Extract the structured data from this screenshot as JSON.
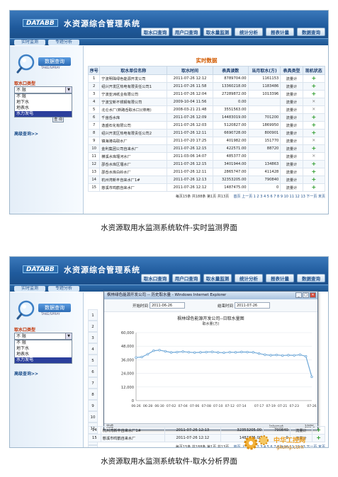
{
  "app": {
    "logo": "DATABB",
    "title": "水资源综合管理系统",
    "nav_tabs": [
      "取水口查询",
      "用户口查询",
      "取水量监测",
      "统计分析",
      "报表计量",
      "数据查询"
    ],
    "subtabs": [
      "实时监测",
      "专题分析"
    ]
  },
  "sidebar": {
    "title": "数据查询",
    "subtitle": "TAKE/SPRAY",
    "type_label": "取水口类型",
    "select_value": "不 限",
    "options": [
      "不 限",
      "地下水",
      "地表水",
      "水力发电"
    ],
    "selected_option": "水力发电",
    "query_button": "查 询",
    "advanced_link": "高级查询>>"
  },
  "realtime": {
    "title": "实时数据",
    "columns": [
      "序号",
      "取水单位名称",
      "取水时间",
      "表具读数",
      "当月取水(方)",
      "表具类型",
      "现机状态"
    ],
    "rows": [
      [
        "1",
        "宁波明珠绿色能源开发公司",
        "2011-07-26 12:12",
        "8789704.00",
        "1161153",
        "流量计"
      ],
      [
        "2",
        "绍兴开发区热电有限责任公司1",
        "2011-07-26 11:58",
        "13360218.00",
        "1183486",
        "流量计"
      ],
      [
        "3",
        "宁波亚洲纸业有限公司",
        "2011-07-26 12:04",
        "27289872.00",
        "1013396",
        "流量计"
      ],
      [
        "4",
        "宁波宝新不锈钢有限公司",
        "2009-10-04 11:56",
        "0.00",
        "",
        "流量计"
      ],
      [
        "5",
        "北仑水厂(新路岙取水口)(停用)",
        "2008-03-21 21:48",
        "3551563.00",
        "",
        "流量计"
      ],
      [
        "6",
        "千亩岙水库",
        "2011-07-26 12:09",
        "14483019.00",
        "701200",
        "流量计"
      ],
      [
        "7",
        "逸盛石化有限公司",
        "2011-07-26 12:03",
        "5120827.00",
        "1869950",
        "流量计"
      ],
      [
        "8",
        "绍兴开发区热电有限责任公司2",
        "2011-07-26 12:11",
        "6690728.00",
        "800901",
        "流量计"
      ],
      [
        "9",
        "镇海港岛取水厂",
        "2011-07-20 17:25",
        "401982.00",
        "151770",
        "流量计"
      ],
      [
        "10",
        "金利集团公司自来水厂",
        "2011-07-26 12:15",
        "422571.00",
        "88720",
        "流量计"
      ],
      [
        "11",
        "横溪水库堰河水厂",
        "2011-03-06 14:07",
        "485377.00",
        "",
        "流量计"
      ],
      [
        "12",
        "邵岙水库区堰水厂",
        "2011-07-26 12:15",
        "3401944.00",
        "134863",
        "流量计"
      ],
      [
        "13",
        "邵岙水库白岭水厂",
        "2011-07-26 12:11",
        "2865747.00",
        "411428",
        "流量计"
      ],
      [
        "14",
        "杭州湾新丰自来水厂1#",
        "2011-07-26 12:13",
        "32353205.00",
        "790840",
        "流量计"
      ],
      [
        "15",
        "慈溪市鸣鹤自来水厂",
        "2011-07-26 12:12",
        "1487475.00",
        "0",
        "流量计"
      ]
    ],
    "status_marks": [
      "+",
      "+",
      "+",
      "✕",
      "✕",
      "+",
      "+",
      "+",
      "✕",
      "+",
      "✕",
      "+",
      "+",
      "+",
      "+"
    ],
    "pager": "每页15条 共188条  第1页 共13页",
    "pager_links": "首页 上一页 1 2 3 4 5 6 7 8 9 10 11 12 13 下一页 末页"
  },
  "popup": {
    "title": "枫林绿色能源开发公司 -- 历史取水量 - Windows Internet Explorer",
    "start_label": "开始时间",
    "start_value": "2011-06-26",
    "end_label": "结束时间",
    "end_value": "2011-07-26",
    "status_left": "完成",
    "status_net": "Internet",
    "status_zoom": "100%"
  },
  "chart_data": {
    "type": "line",
    "title": "枫林绿色能源开发公司--日取水量图",
    "ylabel": "取水量(方)",
    "ylim": [
      0,
      60000
    ],
    "yticks": [
      "60,000",
      "48,000",
      "36,000",
      "24,000",
      "12,000",
      "0"
    ],
    "x": [
      "06-26",
      "06-27",
      "06-28",
      "06-29",
      "06-30",
      "07-01",
      "07-02",
      "07-03",
      "07-04",
      "07-05",
      "07-06",
      "07-07",
      "07-08",
      "07-09",
      "07-10",
      "07-11",
      "07-12",
      "07-13",
      "07-14",
      "07-15",
      "07-16",
      "07-17",
      "07-18",
      "07-19",
      "07-20",
      "07-21",
      "07-22",
      "07-23",
      "07-24",
      "07-25",
      "07-26"
    ],
    "xticks": [
      "06-26",
      "06-28",
      "06-30",
      "07-02",
      "07-04",
      "07-06",
      "07-08",
      "07-10",
      "07-12",
      "07-14",
      "07-17",
      "07-19",
      "07-21",
      "07-23",
      "07-26"
    ],
    "values": [
      38000,
      38500,
      41000,
      44000,
      44500,
      43500,
      42500,
      42800,
      43200,
      42700,
      42400,
      42600,
      42800,
      43000,
      42500,
      42300,
      42700,
      42600,
      42900,
      42800,
      42600,
      41500,
      40500,
      40000,
      40300,
      39800,
      40100,
      39900,
      40500,
      39000,
      21000
    ],
    "color": "#6fa8d8"
  },
  "chart_copy": {
    "title": "枫林绿色能源开发公司--日取水量图",
    "unit": "取水量(方)"
  },
  "bottom_rows": [
    [
      "14",
      "杭州湾新丰自来水厂1#",
      "2011-07-26 12:13",
      "32353205.00",
      "790840",
      "流量计"
    ],
    [
      "15",
      "慈溪市鸣鹤自来水厂",
      "2011-07-26 12:12",
      "1487475.00",
      "0",
      "流量计"
    ]
  ],
  "bg_row_numbers": [
    "1",
    "2",
    "3",
    "4",
    "5",
    "6",
    "7",
    "8",
    "9",
    "10",
    "11",
    "12",
    "13"
  ],
  "captions": {
    "first": "水资源取用水监测系统软件-实时监测界面",
    "second": "水资源取用水监测系统软件-取水分析界面"
  },
  "watermark": {
    "site": "中华工控网",
    "domain": "gkong.com"
  }
}
